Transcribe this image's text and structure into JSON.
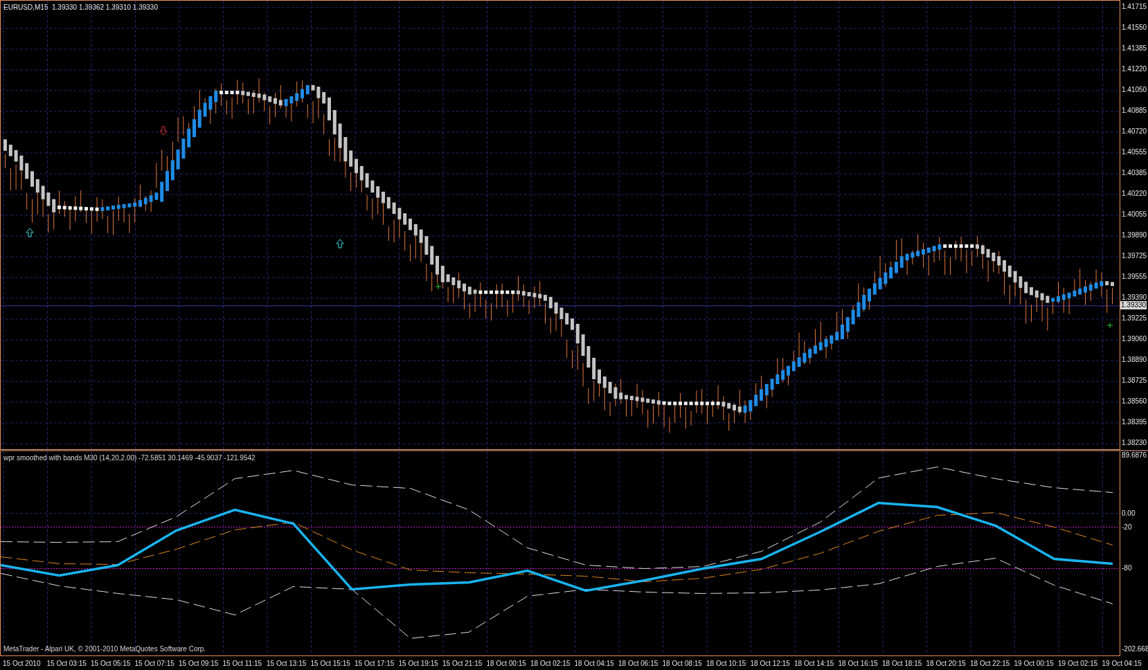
{
  "chart_window": {
    "title": "EURUSD,M15  1.39330 1.39362 1.39310 1.39330"
  },
  "price_axis": {
    "labels": [
      "1.41715",
      "1.41550",
      "1.41385",
      "1.41220",
      "1.41050",
      "1.40885",
      "1.40720",
      "1.40555",
      "1.40385",
      "1.40220",
      "1.40055",
      "1.39890",
      "1.39725",
      "1.39555",
      "1.39390",
      "1.39225",
      "1.39060",
      "1.38890",
      "1.38725",
      "1.38560",
      "1.38395",
      "1.38230"
    ],
    "current_price": "1.39330"
  },
  "indicator": {
    "title": "wpr smoothed with bands M30 (14,20,2.00) -72.5851 30.1469 -45.9037 -121.9542",
    "chart_data": {
      "type": "line",
      "ylim": [
        -202.668,
        89.6876
      ],
      "grid": true,
      "yticks": [
        {
          "value": 89.6876,
          "label": "89.6876"
        },
        {
          "value": 0,
          "label": "0.00"
        },
        {
          "value": -20,
          "label": "-20"
        },
        {
          "value": -80,
          "label": "-80"
        },
        {
          "value": -202.668,
          "label": "-202.668"
        }
      ],
      "series": [
        {
          "color": "#e0e0e0",
          "line_style": "dashed",
          "values": [
            -41,
            -42,
            -41,
            -5,
            50,
            62,
            41,
            36,
            5,
            -50,
            -75,
            -80,
            -77,
            -55,
            -13,
            51,
            67,
            50,
            37,
            30
          ]
        },
        {
          "color": "#e08a1e",
          "line_style": "dashed",
          "values": [
            -63,
            -73,
            -74,
            -52,
            -24,
            -13,
            -53,
            -82,
            -86,
            -88,
            -91,
            -99,
            -94,
            -81,
            -58,
            -26,
            -3,
            1,
            -20,
            -46
          ]
        },
        {
          "color": "#e0e0e0",
          "line_style": "dashed",
          "values": [
            -87,
            -105,
            -116,
            -125,
            -147,
            -106,
            -110,
            -181,
            -172,
            -120,
            -110,
            -114,
            -116,
            -115,
            -111,
            -102,
            -77,
            -65,
            -104,
            -131
          ]
        },
        {
          "color": "#19b4f0",
          "line_style": "solid",
          "values": [
            -75,
            -90,
            -75,
            -25,
            5,
            -15,
            -110,
            -103,
            -100,
            -83,
            -112,
            -97,
            -80,
            -66,
            -27,
            15,
            9,
            -18,
            -66,
            -73
          ]
        }
      ]
    }
  },
  "copyright": "MetaTrader - Alpari UK, © 2001-2010 MetaQuotes Software Corp.",
  "time_axis": {
    "labels": [
      "15 Oct 2010",
      "15 Oct 03:15",
      "15 Oct 05:15",
      "15 Oct 07:15",
      "15 Oct 09:15",
      "15 Oct 11:15",
      "15 Oct 13:15",
      "15 Oct 15:15",
      "15 Oct 17:15",
      "15 Oct 19:15",
      "15 Oct 21:15",
      "18 Oct 00:15",
      "18 Oct 02:15",
      "18 Oct 04:15",
      "18 Oct 06:15",
      "18 Oct 08:15",
      "18 Oct 10:15",
      "18 Oct 12:15",
      "18 Oct 14:15",
      "18 Oct 16:15",
      "18 Oct 18:15",
      "18 Oct 20:15",
      "18 Oct 22:15",
      "19 Oct 00:15",
      "19 Oct 02:15",
      "19 Oct 04:15"
    ]
  }
}
